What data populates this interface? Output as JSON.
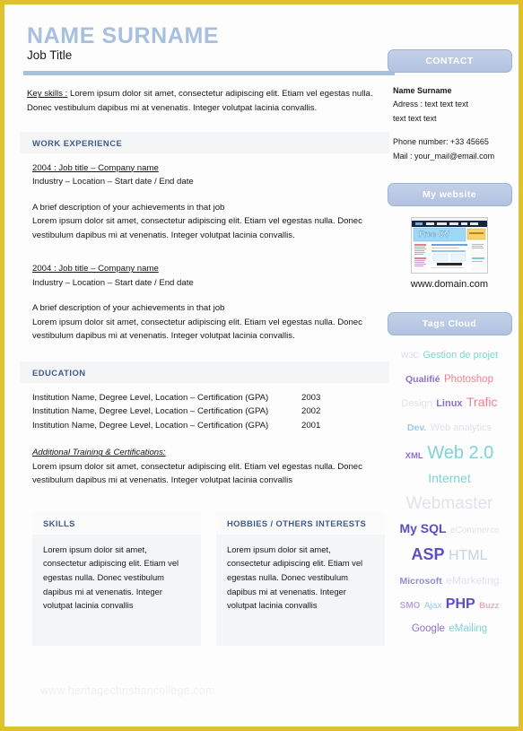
{
  "page": {
    "border_color": "#e0c230",
    "accent_blue": "#a8c0e0",
    "heading_blue": "#3f5a89",
    "watermark": "www.heritagechristiancollege.com"
  },
  "header": {
    "name": "NAME SURNAME",
    "job_title": "Job Title"
  },
  "key_skills": {
    "label": "Key skills :",
    "text": " Lorem ipsum dolor sit amet, consectetur adipiscing elit. Etiam vel egestas nulla. Donec vestibulum dapibus mi at venenatis. Integer volutpat lacinia convallis."
  },
  "work_experience": {
    "title": "WORK EXPERIENCE",
    "entries": [
      {
        "head": "2004 : Job title – Company name",
        "sub": "Industry – Location – Start date / End date",
        "desc_line1": "A brief description of your achievements in that job",
        "desc_line2": "Lorem ipsum dolor sit amet, consectetur adipiscing elit. Etiam vel egestas nulla. Donec vestibulum dapibus mi at venenatis. Integer volutpat lacinia convallis."
      },
      {
        "head": "2004 : Job title – Company name",
        "sub": "Industry – Location – Start date / End date",
        "desc_line1": "A brief description of your achievements in that job",
        "desc_line2": "Lorem ipsum dolor sit amet, consectetur adipiscing elit. Etiam vel egestas nulla. Donec vestibulum dapibus mi at venenatis. Integer volutpat lacinia convallis."
      }
    ]
  },
  "education": {
    "title": "EDUCATION",
    "rows": [
      {
        "institution": "Institution Name, Degree Level, Location – Certification (GPA)",
        "year": "2003"
      },
      {
        "institution": "Institution Name, Degree Level, Location – Certification (GPA)",
        "year": "2002"
      },
      {
        "institution": "Institution Name, Degree Level, Location – Certification (GPA)",
        "year": "2001"
      }
    ],
    "additional_title": "Additional Training & Certifications:",
    "additional_body": "Lorem ipsum dolor sit amet, consectetur adipiscing elit. Etiam vel egestas nulla. Donec vestibulum dapibus mi at venenatis. Integer volutpat lacinia convallis"
  },
  "skills_box": {
    "title": "SKILLS",
    "body": "Lorem ipsum dolor sit amet, consectetur adipiscing elit. Etiam vel egestas nulla. Donec vestibulum dapibus mi at venenatis. Integer volutpat lacinia convallis"
  },
  "hobbies_box": {
    "title": "HOBBIES / OTHERS INTERESTS",
    "body": "Lorem ipsum dolor sit amet, consectetur adipiscing elit. Etiam vel egestas nulla. Donec vestibulum dapibus mi at venenatis. Integer volutpat lacinia convallis"
  },
  "sidebar": {
    "contact": {
      "title": "CONTACT",
      "name": "Name Surname",
      "address_line1": "Adress : text text text",
      "address_line2": "text text text",
      "phone": "Phone number: +33 45665",
      "mail": "Mail : your_mail@email.com"
    },
    "website": {
      "title": "My website",
      "thumbnail_banner": "Free CV",
      "domain": "www.domain.com"
    },
    "tags": {
      "title": "Tags Cloud",
      "rows": [
        [
          {
            "text": "W3C",
            "size": 9,
            "color": "#d8dde6",
            "weight": "normal"
          },
          {
            "text": "Gestion de projet",
            "size": 11,
            "color": "#7fd4d4",
            "weight": "normal"
          }
        ],
        [
          {
            "text": "Qualifié",
            "size": 10.5,
            "color": "#8f6fd0",
            "weight": "bold"
          },
          {
            "text": "Photoshop",
            "size": 11.5,
            "color": "#f08090",
            "weight": "normal"
          }
        ],
        [
          {
            "text": "Design",
            "size": 11,
            "color": "#dfe3ea",
            "weight": "normal"
          },
          {
            "text": "Linux",
            "size": 11,
            "color": "#8f6fd0",
            "weight": "bold"
          },
          {
            "text": "Trafic",
            "size": 14,
            "color": "#f08090",
            "weight": "normal"
          }
        ],
        [
          {
            "text": "Dev.",
            "size": 10.5,
            "color": "#9fc8e8",
            "weight": "bold"
          },
          {
            "text": "Web analytics",
            "size": 11,
            "color": "#dfe3ea",
            "weight": "normal"
          }
        ],
        [
          {
            "text": "XML",
            "size": 9.5,
            "color": "#8f6fd0",
            "weight": "bold"
          },
          {
            "text": "Web 2.0",
            "size": 20,
            "color": "#7fd4d4",
            "weight": "normal"
          }
        ],
        [
          {
            "text": "Internet",
            "size": 14,
            "color": "#7fd4d4",
            "weight": "normal"
          }
        ],
        [
          {
            "text": "Webmaster",
            "size": 19,
            "color": "#dfe3ea",
            "weight": "normal"
          }
        ],
        [
          {
            "text": "My SQL",
            "size": 14,
            "color": "#5a4fc0",
            "weight": "bold"
          },
          {
            "text": "eCommerce",
            "size": 10,
            "color": "#dfe3ea",
            "weight": "normal"
          }
        ],
        [
          {
            "text": "ASP",
            "size": 18,
            "color": "#5a4fc0",
            "weight": "bold"
          },
          {
            "text": "HTML",
            "size": 16,
            "color": "#c3d4e8",
            "weight": "normal"
          }
        ],
        [
          {
            "text": "Microsoft",
            "size": 10.5,
            "color": "#8f8fd0",
            "weight": "bold"
          },
          {
            "text": "eMarketing",
            "size": 12,
            "color": "#dfe3ea",
            "weight": "normal"
          }
        ],
        [
          {
            "text": "SMO",
            "size": 10,
            "color": "#b9a8e0",
            "weight": "bold"
          },
          {
            "text": "Ajax",
            "size": 10,
            "color": "#9fc8e8",
            "weight": "normal"
          },
          {
            "text": "PHP",
            "size": 16,
            "color": "#5a4fc0",
            "weight": "bold"
          },
          {
            "text": "Buzz",
            "size": 9.5,
            "color": "#f0a8b8",
            "weight": "bold"
          }
        ],
        [
          {
            "text": "Google",
            "size": 11.5,
            "color": "#8f6fd0",
            "weight": "normal"
          },
          {
            "text": "eMailing",
            "size": 11.5,
            "color": "#7fd4d4",
            "weight": "normal"
          }
        ]
      ]
    }
  }
}
